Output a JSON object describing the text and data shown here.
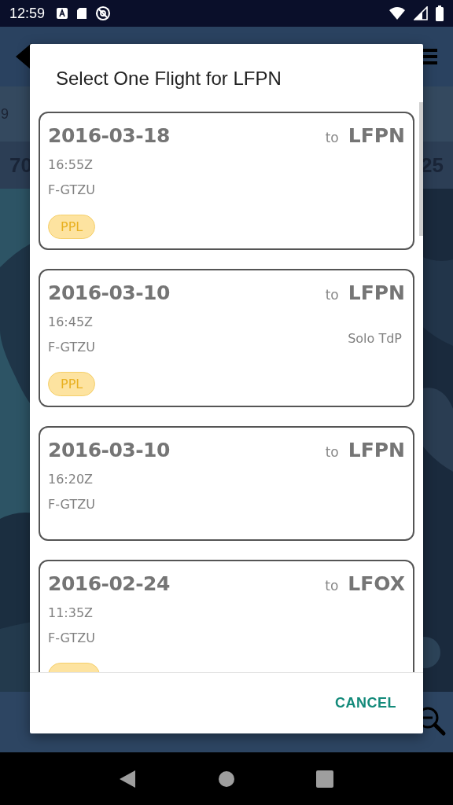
{
  "status_bar": {
    "time": "12:59"
  },
  "background": {
    "row_text": "9",
    "left_value": "70",
    "right_value": "25"
  },
  "dialog": {
    "title": "Select One Flight for LFPN",
    "flights": [
      {
        "date": "2016-03-18",
        "to_label": "to",
        "destination": "LFPN",
        "time": "16:55Z",
        "registration": "F-GTZU",
        "badge": {
          "label": "PPL"
        }
      },
      {
        "date": "2016-03-10",
        "to_label": "to",
        "destination": "LFPN",
        "time": "16:45Z",
        "registration": "F-GTZU",
        "remark": "Solo TdP",
        "badge": {
          "label": "PPL"
        }
      },
      {
        "date": "2016-03-10",
        "to_label": "to",
        "destination": "LFPN",
        "time": "16:20Z",
        "registration": "F-GTZU"
      },
      {
        "date": "2016-02-24",
        "to_label": "to",
        "destination": "LFOX",
        "time": "11:35Z",
        "registration": "F-GTZU",
        "badge_cut": true
      }
    ],
    "cancel": "CANCEL"
  }
}
